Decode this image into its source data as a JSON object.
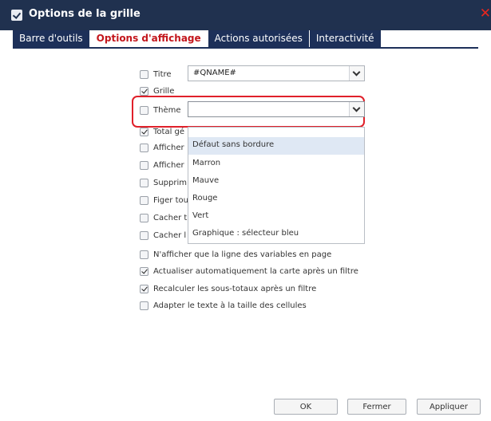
{
  "dialog": {
    "title": "Options de la grille",
    "close_symbol": "✕"
  },
  "tabs": [
    {
      "label": "Barre d'outils",
      "active": false
    },
    {
      "label": "Options d'affichage",
      "active": true
    },
    {
      "label": "Actions autorisées",
      "active": false
    },
    {
      "label": "Interactivité",
      "active": false
    }
  ],
  "options": {
    "titre": {
      "label": "Titre",
      "checked": false,
      "select_value": "#QNAME#"
    },
    "grille": {
      "label": "Grille",
      "checked": true
    },
    "theme": {
      "label": "Thème",
      "checked": false,
      "select_value": ""
    },
    "total": {
      "label": "Total gé",
      "checked": true
    },
    "afficher1": {
      "label": "Afficher",
      "checked": false
    },
    "afficher2": {
      "label": "Afficher",
      "checked": false
    },
    "supprimer": {
      "label": "Supprim",
      "checked": false
    },
    "figer": {
      "label": "Figer tou",
      "checked": false
    },
    "cacher1": {
      "label": "Cacher t",
      "checked": false
    },
    "cacher2": {
      "label": "Cacher l",
      "checked": false
    },
    "nafficher": {
      "label": "N'afficher que la ligne des variables en page",
      "checked": false
    },
    "actualiser": {
      "label": "Actualiser automatiquement la carte après un filtre",
      "checked": true
    },
    "recalculer": {
      "label": "Recalculer les sous-totaux après un filtre",
      "checked": true
    },
    "adapter": {
      "label": "Adapter le texte à la taille des cellules",
      "checked": false
    }
  },
  "theme_dropdown": {
    "items": [
      "Défaut sans bordure",
      "Marron",
      "Mauve",
      "Rouge",
      "Vert",
      "Graphique : sélecteur bleu"
    ],
    "selected_index": 0
  },
  "buttons": {
    "ok": "OK",
    "close": "Fermer",
    "apply": "Appliquer"
  },
  "colors": {
    "header": "#20314f",
    "tab_active_text": "#c3161c",
    "highlight": "#e0202a"
  }
}
